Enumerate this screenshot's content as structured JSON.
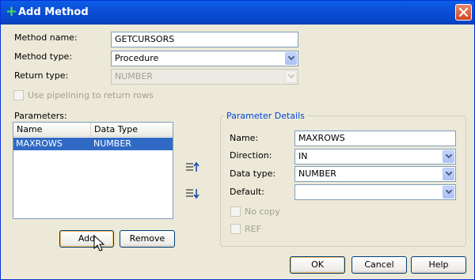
{
  "dialog": {
    "title": "Add Method"
  },
  "form": {
    "method_name_label": "Method name:",
    "method_name_value": "GETCURSORS",
    "method_type_label": "Method type:",
    "method_type_value": "Procedure",
    "return_type_label": "Return type:",
    "return_type_value": "NUMBER",
    "pipelining_label": "Use pipelining to return rows",
    "parameters_label": "Parameters:"
  },
  "parameters_table": {
    "columns": [
      "Name",
      "Data Type"
    ],
    "rows": [
      {
        "name": "MAXROWS",
        "data_type": "NUMBER"
      }
    ]
  },
  "buttons": {
    "add": "Add",
    "remove": "Remove",
    "ok": "OK",
    "cancel": "Cancel",
    "help": "Help"
  },
  "parameter_details": {
    "title": "Parameter Details",
    "name_label": "Name:",
    "name_value": "MAXROWS",
    "direction_label": "Direction:",
    "direction_value": "IN",
    "data_type_label": "Data type:",
    "data_type_value": "NUMBER",
    "default_label": "Default:",
    "default_value": "",
    "no_copy_label": "No copy",
    "ref_label": "REF"
  },
  "icons": {
    "title": "plus-icon",
    "close": "close-icon",
    "move_up": "move-up-icon",
    "move_down": "move-down-icon",
    "cursor": "mouse-cursor-icon"
  },
  "colors": {
    "titlebar": "#0c4fd6",
    "selection": "#316ac5",
    "group_title": "#0046d5",
    "close_button": "#d2451e"
  }
}
